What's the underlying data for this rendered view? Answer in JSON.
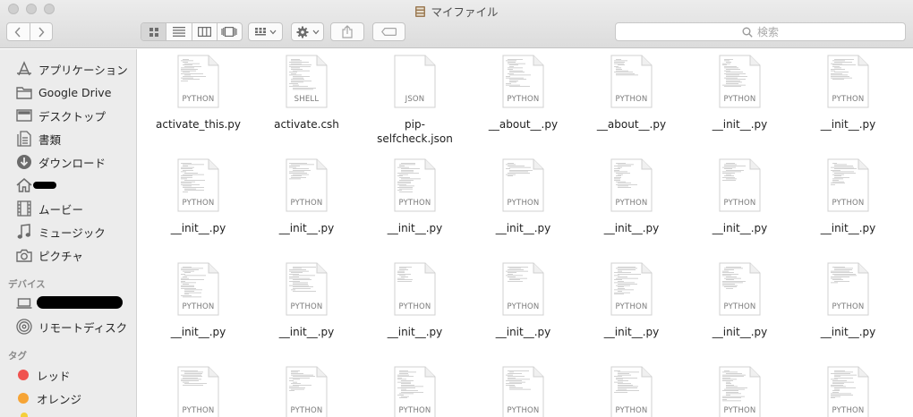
{
  "window": {
    "title": "マイファイル"
  },
  "search": {
    "placeholder": "検索"
  },
  "sidebar": {
    "favorites": [
      {
        "label": "アプリケーション",
        "icon": "applications-icon"
      },
      {
        "label": "Google Drive",
        "icon": "folder-icon"
      },
      {
        "label": "デスクトップ",
        "icon": "desktop-icon"
      },
      {
        "label": "書類",
        "icon": "documents-icon"
      },
      {
        "label": "ダウンロード",
        "icon": "download-icon"
      },
      {
        "label": "",
        "icon": "home-icon"
      },
      {
        "label": "ムービー",
        "icon": "movies-icon"
      },
      {
        "label": "ミュージック",
        "icon": "music-icon"
      },
      {
        "label": "ピクチャ",
        "icon": "pictures-icon"
      }
    ],
    "devices_header": "デバイス",
    "devices": [
      {
        "label": "",
        "icon": "laptop-icon"
      },
      {
        "label": "リモートディスク",
        "icon": "remote-disc-icon"
      }
    ],
    "tags_header": "タグ",
    "tags": [
      {
        "label": "レッド",
        "color": "#f0524f"
      },
      {
        "label": "オレンジ",
        "color": "#f6a435"
      }
    ]
  },
  "files": [
    {
      "name": "activate_this.py",
      "type": "PYTHON"
    },
    {
      "name": "activate.csh",
      "type": "SHELL"
    },
    {
      "name": "pip-selfcheck.json",
      "type": "JSON"
    },
    {
      "name": "__about__.py",
      "type": "PYTHON"
    },
    {
      "name": "__about__.py",
      "type": "PYTHON"
    },
    {
      "name": "__init__.py",
      "type": "PYTHON"
    },
    {
      "name": "__init__.py",
      "type": "PYTHON"
    },
    {
      "name": "__init__.py",
      "type": "PYTHON"
    },
    {
      "name": "__init__.py",
      "type": "PYTHON"
    },
    {
      "name": "__init__.py",
      "type": "PYTHON"
    },
    {
      "name": "__init__.py",
      "type": "PYTHON"
    },
    {
      "name": "__init__.py",
      "type": "PYTHON"
    },
    {
      "name": "__init__.py",
      "type": "PYTHON"
    },
    {
      "name": "__init__.py",
      "type": "PYTHON"
    },
    {
      "name": "__init__.py",
      "type": "PYTHON"
    },
    {
      "name": "__init__.py",
      "type": "PYTHON"
    },
    {
      "name": "__init__.py",
      "type": "PYTHON"
    },
    {
      "name": "__init__.py",
      "type": "PYTHON"
    },
    {
      "name": "__init__.py",
      "type": "PYTHON"
    },
    {
      "name": "__init__.py",
      "type": "PYTHON"
    },
    {
      "name": "__init__.py",
      "type": "PYTHON"
    },
    {
      "name": "",
      "type": "PYTHON"
    },
    {
      "name": "",
      "type": "PYTHON"
    },
    {
      "name": "",
      "type": "PYTHON"
    },
    {
      "name": "",
      "type": "PYTHON"
    },
    {
      "name": "",
      "type": "PYTHON"
    },
    {
      "name": "",
      "type": "PYTHON"
    },
    {
      "name": "",
      "type": "PYTHON"
    }
  ]
}
